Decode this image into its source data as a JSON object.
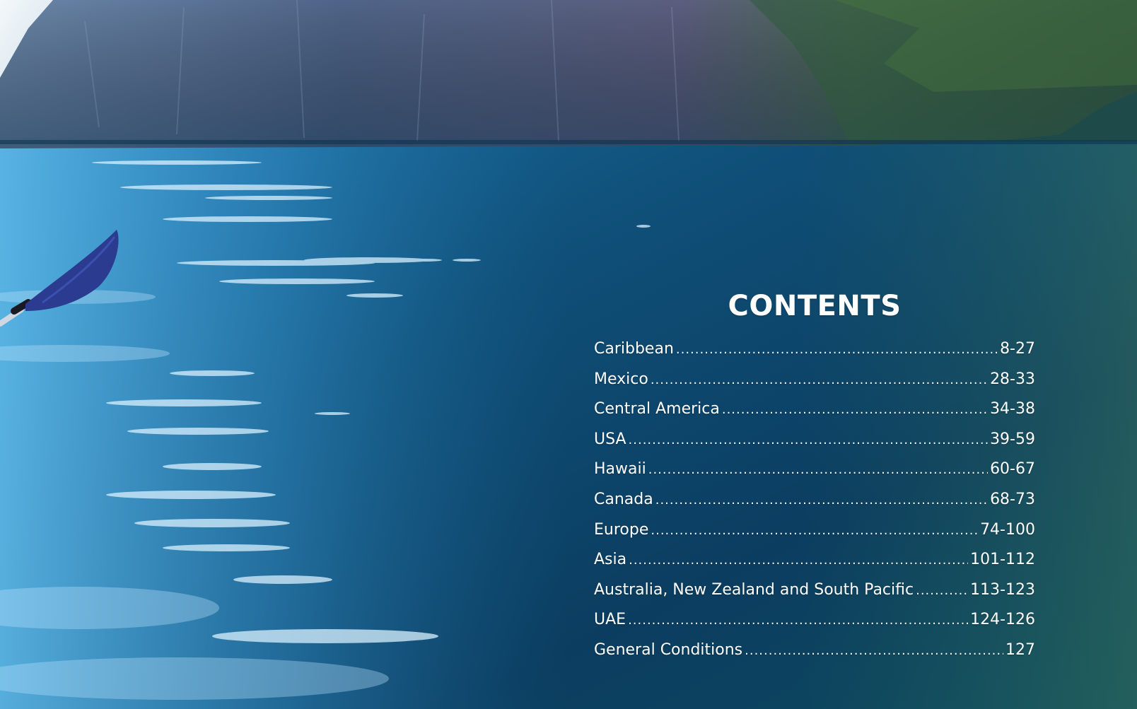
{
  "contents": {
    "title": "CONTENTS",
    "entries": [
      {
        "label": "Caribbean",
        "pages": "8-27"
      },
      {
        "label": "Mexico",
        "pages": "28-33"
      },
      {
        "label": "Central America",
        "pages": "34-38"
      },
      {
        "label": "USA",
        "pages": "39-59"
      },
      {
        "label": "Hawaii",
        "pages": "60-67"
      },
      {
        "label": "Canada",
        "pages": "68-73"
      },
      {
        "label": "Europe",
        "pages": "74-100"
      },
      {
        "label": "Asia",
        "pages": "101-112"
      },
      {
        "label": "Australia, New Zealand and South Pacific",
        "pages": "113-123"
      },
      {
        "label": "UAE",
        "pages": "124-126"
      },
      {
        "label": "General Conditions",
        "pages": "127"
      }
    ]
  },
  "colors": {
    "water_deep": "#0b3a5a",
    "water_light": "#4fb0e6",
    "cliff": "#3f5a78",
    "paddle": "#2a3a8c",
    "text": "#ffffff"
  },
  "icons": {
    "paddle": "kayak-paddle"
  }
}
